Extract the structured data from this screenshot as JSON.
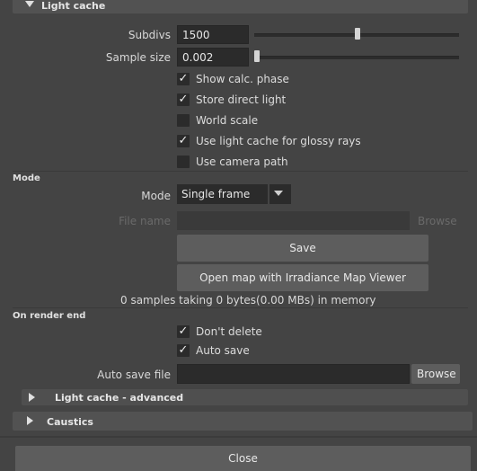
{
  "light_cache": {
    "header": "Light cache",
    "subdivs_label": "Subdivs",
    "subdivs_value": "1500",
    "subdivs_slider_fraction": 0.6,
    "sample_size_label": "Sample size",
    "sample_size_value": "0.002",
    "sample_size_slider_fraction": 0.0,
    "checkboxes": [
      {
        "label": "Show calc. phase",
        "checked": true
      },
      {
        "label": "Store direct light",
        "checked": true
      },
      {
        "label": "World scale",
        "checked": false
      },
      {
        "label": "Use light cache for glossy rays",
        "checked": true
      },
      {
        "label": "Use camera path",
        "checked": false
      }
    ]
  },
  "mode_section": {
    "title": "Mode",
    "mode_label": "Mode",
    "mode_value": "Single frame",
    "file_name_label": "File name",
    "file_name_value": "",
    "browse_label": "Browse",
    "save_label": "Save",
    "open_map_label": "Open map with Irradiance Map Viewer",
    "memory_text": "0 samples taking 0 bytes(0.00 MBs) in memory"
  },
  "render_end": {
    "title": "On render end",
    "checkboxes": [
      {
        "label": "Don't delete",
        "checked": true
      },
      {
        "label": "Auto save",
        "checked": true
      }
    ],
    "auto_save_label": "Auto save file",
    "auto_save_value": "",
    "browse_label": "Browse"
  },
  "collapsed_sections": {
    "advanced": "Light cache - advanced",
    "caustics": "Caustics"
  },
  "close_label": "Close",
  "check_glyph": "✓"
}
